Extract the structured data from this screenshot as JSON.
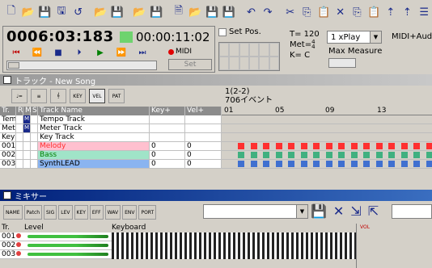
{
  "transport": {
    "time_main": "0006:03:183",
    "time_sub": "00:00:11:02",
    "midi_label": "MIDI",
    "set_label": "Set"
  },
  "setpos": {
    "label": "Set Pos."
  },
  "tempo": {
    "tempo_line": "T= 120",
    "meter_prefix": "Met=",
    "meter_num": "4",
    "meter_den": "4",
    "key_line": "K= C"
  },
  "play": {
    "select_value": "1 xPlay",
    "midi_aud": "MIDI+Aud",
    "max_measure": "Max Measure"
  },
  "track_window": {
    "title": "トラック - New Song",
    "measure_range": "1(2-2)",
    "event_count": "706イベント",
    "columns": [
      "Tr.",
      "R",
      "M",
      "S",
      "Track Name",
      "Key+",
      "Vel+"
    ],
    "measure_labels": [
      "01",
      "05",
      "09",
      "13"
    ],
    "rows": [
      {
        "tr": "Tem",
        "m": "M",
        "name": "Tempo Track",
        "key": "",
        "vel": ""
      },
      {
        "tr": "Met",
        "m": "M",
        "name": "Meter Track",
        "key": "",
        "vel": ""
      },
      {
        "tr": "Key",
        "m": "",
        "name": "Key Track",
        "key": "",
        "vel": ""
      },
      {
        "tr": "001",
        "m": "",
        "name": "Melody",
        "key": "0",
        "vel": "0"
      },
      {
        "tr": "002",
        "m": "",
        "name": "Bass",
        "key": "0",
        "vel": "0"
      },
      {
        "tr": "003",
        "m": "",
        "name": "SynthLEAD",
        "key": "0",
        "vel": "0"
      }
    ]
  },
  "mixer_window": {
    "title": "ミキサー",
    "toolbar": [
      "NAME",
      "Patch",
      "SIG",
      "LEV",
      "KEY",
      "EFF",
      "WAV",
      "ENV",
      "PORT"
    ],
    "header_tr": "Tr.",
    "header_level": "Level",
    "header_keyboard": "Keyboard",
    "vol_label": "VOL",
    "rows": [
      {
        "tr": "001"
      },
      {
        "tr": "002"
      },
      {
        "tr": "003"
      }
    ]
  },
  "colors": {
    "melody": "#ff3030",
    "bass": "#40b080",
    "synth": "#4070d0",
    "mixer_title": "#00207a"
  }
}
